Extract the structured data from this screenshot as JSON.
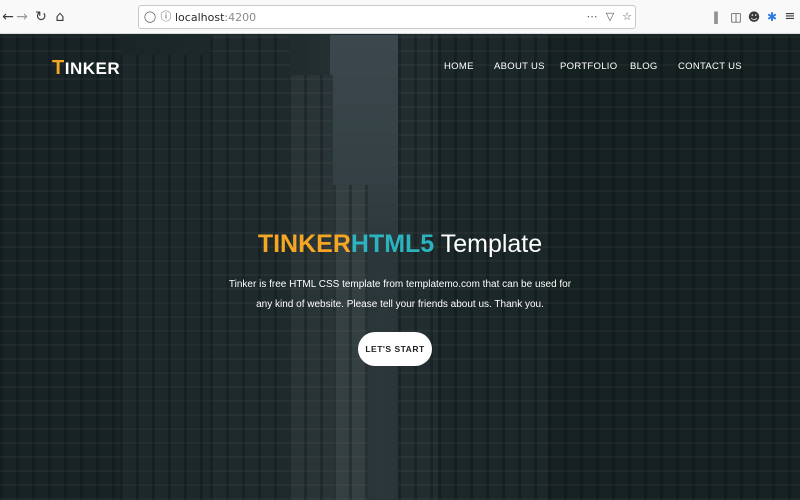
{
  "browser": {
    "url_host": "localhost",
    "url_port": ":4200",
    "icons": [
      "back-icon",
      "forward-icon",
      "reload-icon",
      "home-icon",
      "shield-icon",
      "info-icon",
      "more-icon",
      "pocket-icon",
      "bookmark-star-icon",
      "library-icon",
      "sidebar-icon",
      "account-icon",
      "extension-icon",
      "menu-icon"
    ]
  },
  "site": {
    "logo_first": "T",
    "logo_rest": "INKER",
    "nav": [
      "HOME",
      "ABOUT US",
      "PORTFOLIO",
      "BLOG",
      "CONTACT US"
    ]
  },
  "hero": {
    "title_part1": "TINKER",
    "title_part2": "HTML5",
    "title_part3": " Template",
    "description": "Tinker is free HTML CSS template from templatemo.com that can be used for any kind of website. Please tell your friends about us. Thank you.",
    "cta_label": "LET'S START"
  },
  "colors": {
    "accent_orange": "#f5a623",
    "accent_teal": "#2bb3c0"
  }
}
